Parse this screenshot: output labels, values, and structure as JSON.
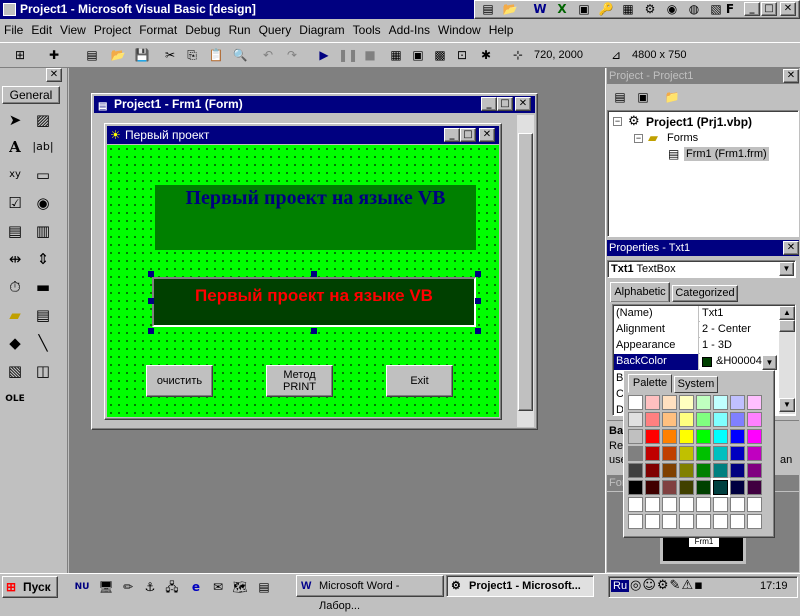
{
  "app": {
    "title": "Project1 - Microsoft Visual Basic [design]"
  },
  "menu": [
    "File",
    "Edit",
    "View",
    "Project",
    "Format",
    "Debug",
    "Run",
    "Query",
    "Diagram",
    "Tools",
    "Add-Ins",
    "Window",
    "Help"
  ],
  "toolbar": {
    "position": "720, 2000",
    "size": "4800 x 750"
  },
  "toolbox": {
    "tab": "General"
  },
  "formwin": {
    "title": "Project1 - Frm1 (Form)"
  },
  "form": {
    "title": "Первый проект",
    "label_text": "Первый проект на языке VB",
    "textbox_text": "Первый проект на языке VB",
    "btn_clear": "очистить",
    "btn_print_1": "Метод",
    "btn_print_2": "PRINT",
    "btn_exit": "Exit"
  },
  "project": {
    "title": "Project - Project1",
    "root": "Project1 (Prj1.vbp)",
    "folder": "Forms",
    "item": "Frm1 (Frm1.frm)"
  },
  "props": {
    "title": "Properties - Txt1",
    "object_name": "Txt1",
    "object_type": "TextBox",
    "tabs": [
      "Alphabetic",
      "Categorized"
    ],
    "rows": [
      {
        "name": "(Name)",
        "value": "Txt1"
      },
      {
        "name": "Alignment",
        "value": "2 - Center"
      },
      {
        "name": "Appearance",
        "value": "1 - 3D"
      },
      {
        "name": "BackColor",
        "value": "&H00004"
      }
    ],
    "partial_rows": [
      "Bo",
      "Ca",
      "D"
    ],
    "desc_title": "Ba",
    "desc_lines": [
      "Re",
      "use",
      "an"
    ],
    "palette_tabs": [
      "Palette",
      "System"
    ],
    "palette_colors": [
      "#ffffff",
      "#ffc0c0",
      "#ffe0c0",
      "#ffffc0",
      "#c0ffc0",
      "#c0ffff",
      "#c0c0ff",
      "#ffc0ff",
      "#e0e0e0",
      "#ff8080",
      "#ffc080",
      "#ffff80",
      "#80ff80",
      "#80ffff",
      "#8080ff",
      "#ff80ff",
      "#c0c0c0",
      "#ff0000",
      "#ff8000",
      "#ffff00",
      "#00ff00",
      "#00ffff",
      "#0000ff",
      "#ff00ff",
      "#808080",
      "#c00000",
      "#c04000",
      "#c0c000",
      "#00c000",
      "#00c0c0",
      "#0000c0",
      "#c000c0",
      "#404040",
      "#800000",
      "#804000",
      "#808000",
      "#008000",
      "#008080",
      "#000080",
      "#800080",
      "#000000",
      "#400000",
      "#804040",
      "#404000",
      "#004000",
      "#004040",
      "#000040",
      "#400040",
      "#ffffff",
      "#ffffff",
      "#ffffff",
      "#ffffff",
      "#ffffff",
      "#ffffff",
      "#ffffff",
      "#ffffff",
      "#ffffff",
      "#ffffff",
      "#ffffff",
      "#ffffff",
      "#ffffff",
      "#ffffff",
      "#ffffff",
      "#ffffff"
    ],
    "selected_swatch": 45
  },
  "layout_panel": {
    "title": "For",
    "thumb": "Frm1"
  },
  "taskbar": {
    "start": "Пуск",
    "task1": "Microsoft Word - Лабор...",
    "task2": "Project1 - Microsoft...",
    "lang": "Ru",
    "time": "17:19"
  },
  "colors": {
    "form_bg": "#00ff00",
    "label_bg": "#008000",
    "label_fg": "#000080",
    "textbox_bg": "#004000",
    "textbox_fg": "#ff0000",
    "title": "#000080"
  }
}
